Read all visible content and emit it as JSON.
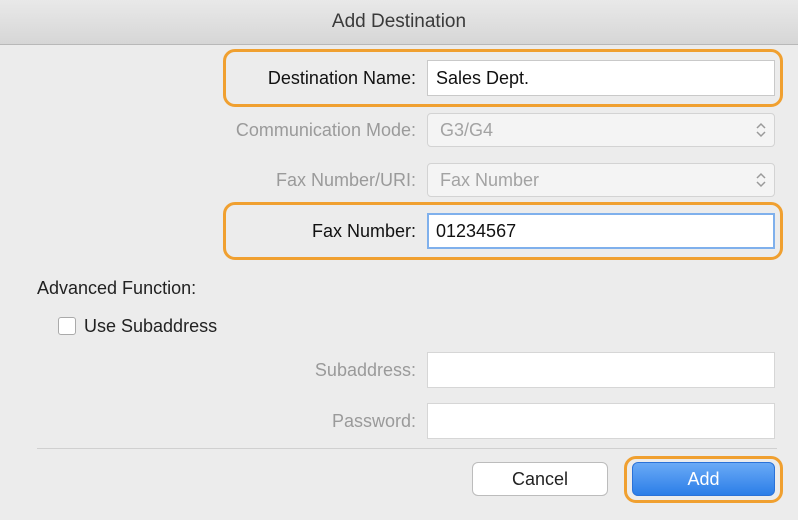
{
  "window": {
    "title": "Add Destination"
  },
  "form": {
    "destination_name": {
      "label": "Destination Name:",
      "value": "Sales Dept."
    },
    "communication_mode": {
      "label": "Communication Mode:",
      "value": "G3/G4"
    },
    "fax_number_uri": {
      "label": "Fax Number/URI:",
      "value": "Fax Number"
    },
    "fax_number": {
      "label": "Fax Number:",
      "value": "01234567"
    },
    "advanced": {
      "heading": "Advanced Function:",
      "use_subaddress": {
        "label": "Use Subaddress",
        "checked": false
      },
      "subaddress": {
        "label": "Subaddress:",
        "value": ""
      },
      "password": {
        "label": "Password:",
        "value": ""
      }
    }
  },
  "buttons": {
    "cancel": "Cancel",
    "add": "Add"
  },
  "colors": {
    "highlight": "#f0a030",
    "primary": "#2b7ee8",
    "focus_ring": "#7fb0ec"
  },
  "icons": {
    "select_arrow": "updown-chevron-icon"
  }
}
